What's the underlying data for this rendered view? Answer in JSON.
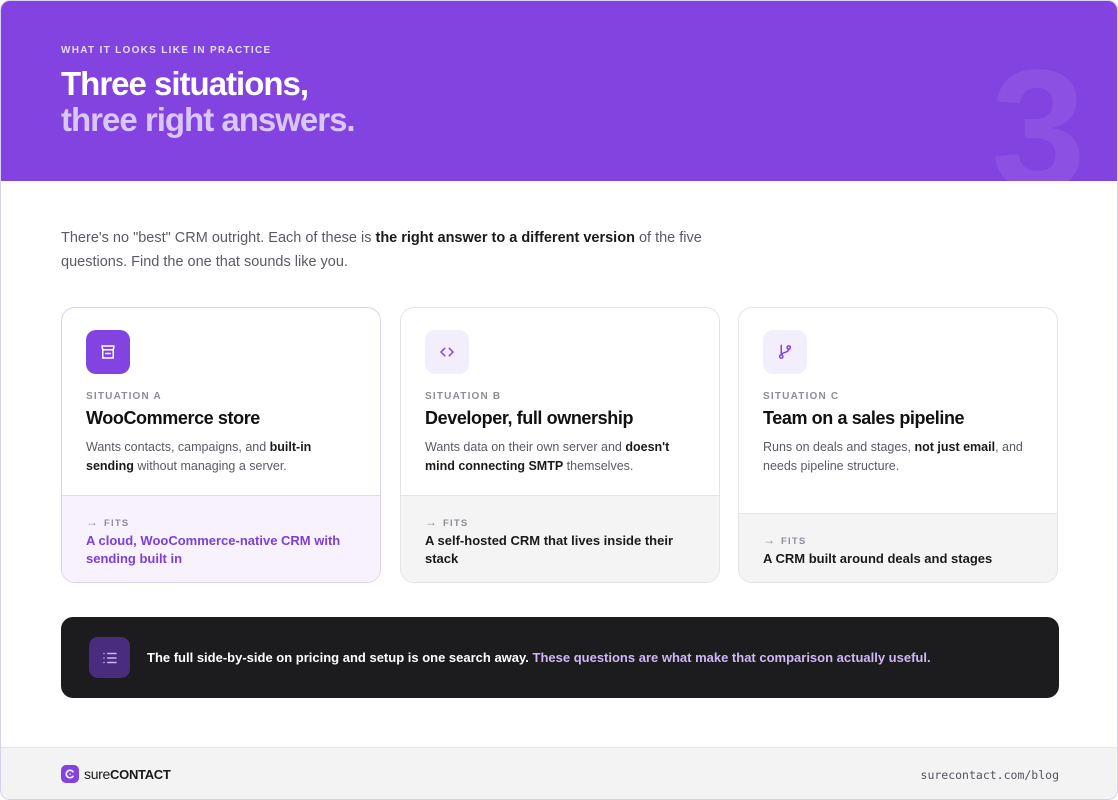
{
  "header": {
    "eyebrow": "WHAT IT LOOKS LIKE IN PRACTICE",
    "title_line1": "Three situations,",
    "title_line2": "three right answers.",
    "big_number": "3",
    "bg_color": "#8343e0"
  },
  "intro": {
    "part1": "There's no \"best\" CRM outright. Each of these is ",
    "bold": "the right answer to a different version",
    "part2": " of the five questions. Find the one that sounds like you."
  },
  "cards": [
    {
      "icon": "storefront-icon",
      "label": "SITUATION A",
      "title": "WooCommerce store",
      "desc_part1": "Wants contacts, campaigns, and ",
      "desc_bold": "built-in sending",
      "desc_part2": " without managing a server.",
      "fits_label": "FITS",
      "fits_text": "A cloud, WooCommerce-native CRM with sending built in"
    },
    {
      "icon": "code-icon",
      "label": "SITUATION B",
      "title": "Developer, full ownership",
      "desc_part1": "Wants data on their own server and ",
      "desc_bold": "doesn't mind connecting SMTP",
      "desc_part2": " themselves.",
      "fits_label": "FITS",
      "fits_text": "A self-hosted CRM that lives inside their stack"
    },
    {
      "icon": "git-branch-icon",
      "label": "SITUATION C",
      "title": "Team on a sales pipeline",
      "desc_part1": "Runs on deals and stages, ",
      "desc_bold": "not just email",
      "desc_part2": ", and needs pipeline structure.",
      "fits_label": "FITS",
      "fits_text": "A CRM built around deals and stages"
    }
  ],
  "banner": {
    "icon": "list-icon",
    "text_white": "The full side-by-side on pricing and setup is one search away.",
    "text_purple": " These questions are what make that comparison actually useful."
  },
  "footer": {
    "logo_sure": "sure",
    "logo_contact": "CONTACT",
    "url": "surecontact.com/blog"
  },
  "colors": {
    "accent": "#8343e0",
    "accent_text": "#7c3fd8",
    "dark_banner": "#1c1b1e"
  }
}
